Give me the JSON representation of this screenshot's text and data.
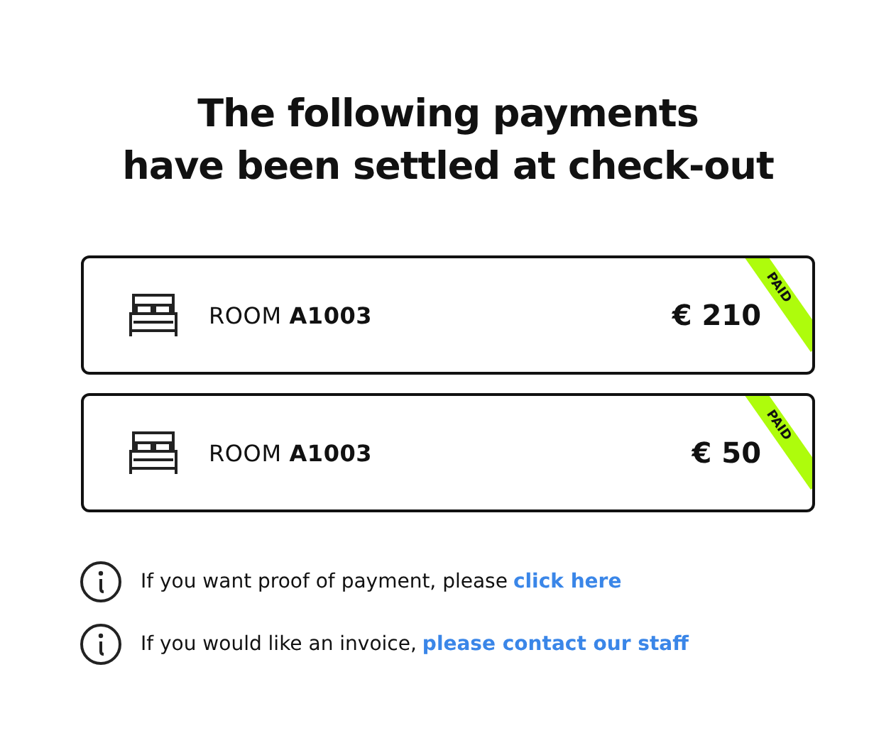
{
  "title_lines": [
    "The following payments",
    "have been settled at check-out"
  ],
  "payments": [
    {
      "label": "ROOM **A1003**",
      "amount": "€ 210",
      "paid": true,
      "badge": "PAID"
    },
    {
      "label": "ROOM **A1003**",
      "amount": "€ 50",
      "paid": true,
      "badge": "PAID"
    }
  ],
  "notes": [
    {
      "text": "If you want proof of payment, please",
      "link": "click here"
    },
    {
      "text": "If you would like an invoice,",
      "link": "please contact our staff"
    }
  ]
}
